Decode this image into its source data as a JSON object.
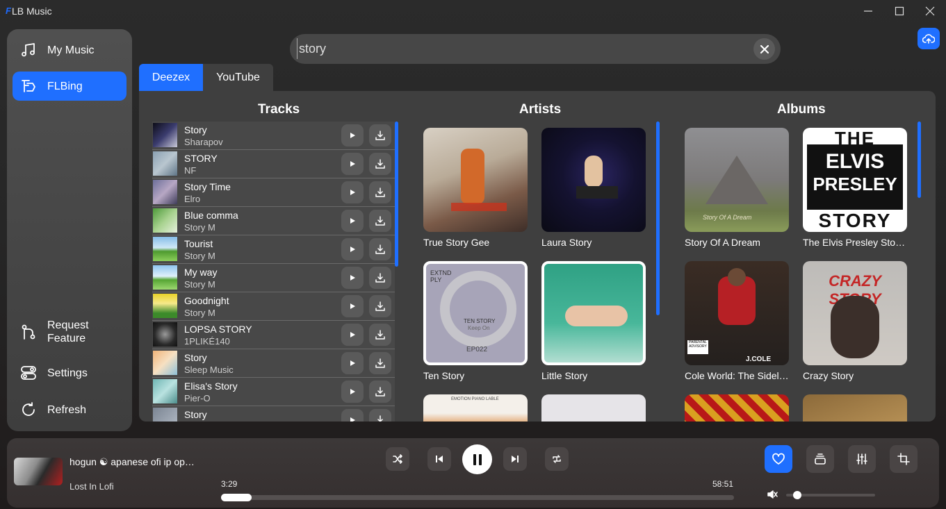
{
  "app": {
    "logo": "F",
    "title": "LB Music"
  },
  "sidebar": {
    "items": [
      {
        "label": "My Music",
        "icon": "music-note-icon"
      },
      {
        "label": "FLBing",
        "icon": "flbing-logo-icon"
      },
      {
        "label": "Request Feature",
        "icon": "pull-request-icon"
      },
      {
        "label": "Settings",
        "icon": "toggles-icon"
      },
      {
        "label": "Refresh",
        "icon": "refresh-icon"
      }
    ],
    "active": "FLBing"
  },
  "search": {
    "value": "story",
    "placeholder": ""
  },
  "tabs": [
    {
      "label": "Deezex",
      "active": true
    },
    {
      "label": "YouTube",
      "active": false
    }
  ],
  "columns": {
    "tracks": "Tracks",
    "artists": "Artists",
    "albums": "Albums"
  },
  "tracks": [
    {
      "title": "Story",
      "artist": "Sharapov"
    },
    {
      "title": "STORY",
      "artist": "NF"
    },
    {
      "title": "Story Time",
      "artist": "Elro"
    },
    {
      "title": "Blue comma",
      "artist": "Story M"
    },
    {
      "title": "Tourist",
      "artist": "Story M"
    },
    {
      "title": "My way",
      "artist": "Story M"
    },
    {
      "title": "Goodnight",
      "artist": "Story M"
    },
    {
      "title": "LOPSA STORY",
      "artist": "1PLIKÉ140"
    },
    {
      "title": "Story",
      "artist": "Sleep Music"
    },
    {
      "title": "Elisa's Story",
      "artist": "Pier-O"
    },
    {
      "title": "Story",
      "artist": ""
    }
  ],
  "artists": [
    {
      "name": "True Story Gee"
    },
    {
      "name": "Laura Story"
    },
    {
      "name": "Ten Story",
      "art_text": [
        "EXTND",
        "PLY",
        "TEN STORY",
        "Keep On",
        "EP022"
      ]
    },
    {
      "name": "Little Story"
    },
    {
      "name": "",
      "art_text": [
        "EMOTION PIANO LABLE"
      ]
    },
    {
      "name": ""
    }
  ],
  "albums": [
    {
      "name": "Story Of A Dream",
      "art_text": [
        "Story Of A Dream"
      ]
    },
    {
      "name": "The Elvis Presley Stor…",
      "art_text": [
        "THE",
        "ELVIS",
        "PRESLEY",
        "STORY"
      ]
    },
    {
      "name": "Cole World: The Sideli…",
      "art_text": [
        "J.COLE",
        "PARENTAL ADVISORY"
      ]
    },
    {
      "name": "Crazy Story",
      "art_text": [
        "CRAZY STORY"
      ]
    },
    {
      "name": ""
    },
    {
      "name": ""
    }
  ],
  "player": {
    "title": "hogun ☯ apanese ofi ip op…",
    "artist": "Lost In Lofi",
    "elapsed": "3:29",
    "duration": "58:51",
    "progress": 0.06,
    "volume": 0.08,
    "liked": true
  },
  "colors": {
    "accent": "#1f6fff",
    "panel": "#3f3f3f",
    "sidebar": "#4a4a4a"
  }
}
